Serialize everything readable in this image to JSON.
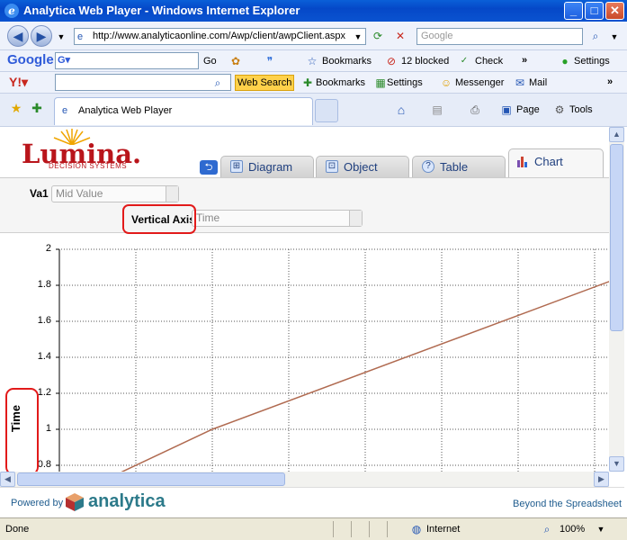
{
  "window": {
    "title": "Analytica Web Player - Windows Internet Explorer"
  },
  "address_bar": {
    "url": "http://www.analyticaonline.com/Awp/client/awpClient.aspx",
    "search_placeholder": "Google"
  },
  "google_toolbar": {
    "brand": "Google",
    "go": "Go",
    "bookmarks": "Bookmarks",
    "blocked": "12 blocked",
    "check": "Check",
    "settings": "Settings"
  },
  "yahoo_toolbar": {
    "web_search": "Web Search",
    "bookmarks": "Bookmarks",
    "settings": "Settings",
    "messenger": "Messenger",
    "mail": "Mail"
  },
  "favorites_bar": {
    "tab_title": "Analytica Web Player",
    "page": "Page",
    "tools": "Tools"
  },
  "app": {
    "logo_name": "Lumina.",
    "logo_sub": "DECISION SYSTEMS",
    "tabs": [
      {
        "label": "Diagram"
      },
      {
        "label": "Object"
      },
      {
        "label": "Table"
      },
      {
        "label": "Chart"
      }
    ],
    "va1_label": "Va1",
    "va1_value": "Mid Value",
    "vertical_axis_label": "Vertical Axis",
    "vertical_axis_value": "Time",
    "y_axis_title": "Time",
    "footer_powered": "Powered by",
    "footer_brand": "analytica",
    "footer_slogan": "Beyond the Spreadsheet"
  },
  "chart_data": {
    "type": "line",
    "y_ticks": [
      "2",
      "1.8",
      "1.6",
      "1.4",
      "1.2",
      "1",
      "0.8"
    ],
    "ylim": [
      0.8,
      2
    ],
    "ylabel": "Time",
    "grid": true,
    "series": [
      {
        "points": [
          [
            0.8,
            0.76
          ],
          [
            2,
            1.0
          ],
          [
            7.5,
            1.87
          ]
        ]
      }
    ],
    "color": "#b06a50"
  },
  "status": {
    "text": "Done",
    "zone": "Internet",
    "zoom": "100%"
  }
}
